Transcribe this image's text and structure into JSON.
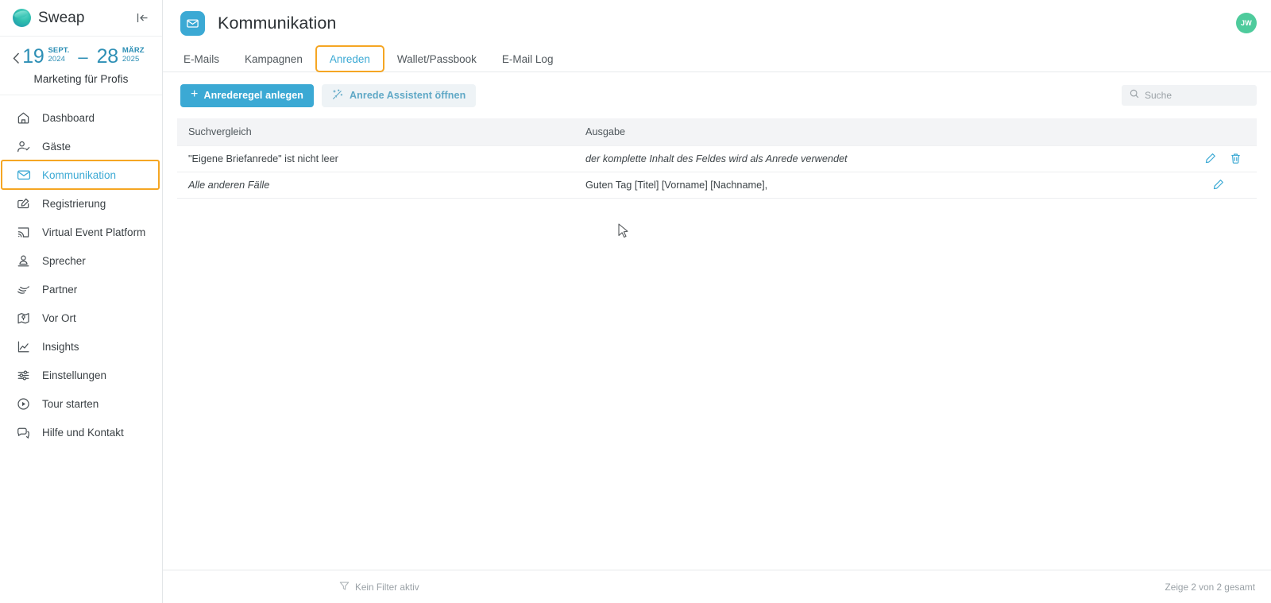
{
  "sidebar": {
    "brand": "Sweap",
    "collapse_icon": "collapse-panel-icon",
    "date_range": {
      "prev_icon": "chevron-left-icon",
      "start_day": "19",
      "start_month": "SEPT.",
      "start_year": "2024",
      "separator": "–",
      "end_day": "28",
      "end_month": "MÄRZ",
      "end_year": "2025",
      "event_name": "Marketing für Profis"
    },
    "items": [
      {
        "label": "Dashboard",
        "icon": "home-icon",
        "active": false
      },
      {
        "label": "Gäste",
        "icon": "user-check-icon",
        "active": false
      },
      {
        "label": "Kommunikation",
        "icon": "envelope-icon",
        "active": true
      },
      {
        "label": "Registrierung",
        "icon": "form-edit-icon",
        "active": false
      },
      {
        "label": "Virtual Event Platform",
        "icon": "cast-screen-icon",
        "active": false
      },
      {
        "label": "Sprecher",
        "icon": "speaker-person-icon",
        "active": false
      },
      {
        "label": "Partner",
        "icon": "handshake-icon",
        "active": false
      },
      {
        "label": "Vor Ort",
        "icon": "map-pin-icon",
        "active": false
      },
      {
        "label": "Insights",
        "icon": "chart-line-icon",
        "active": false
      },
      {
        "label": "Einstellungen",
        "icon": "sliders-icon",
        "active": false
      }
    ],
    "bottom_items": [
      {
        "label": "Tour starten",
        "icon": "play-circle-icon"
      },
      {
        "label": "Hilfe und Kontakt",
        "icon": "chat-bubbles-icon"
      }
    ]
  },
  "header": {
    "icon": "envelope-icon",
    "title": "Kommunikation",
    "avatar_initials": "JW"
  },
  "tabs": [
    {
      "label": "E-Mails",
      "active": false
    },
    {
      "label": "Kampagnen",
      "active": false
    },
    {
      "label": "Anreden",
      "active": true
    },
    {
      "label": "Wallet/Passbook",
      "active": false
    },
    {
      "label": "E-Mail Log",
      "active": false
    }
  ],
  "toolbar": {
    "create_rule_label": "Anrederegel anlegen",
    "create_rule_icon": "plus-icon",
    "assistant_label": "Anrede Assistent öffnen",
    "assistant_icon": "magic-wand-icon",
    "search_placeholder": "Suche",
    "search_value": "",
    "search_icon": "search-icon"
  },
  "table": {
    "columns": [
      "Suchvergleich",
      "Ausgabe"
    ],
    "rows": [
      {
        "match": "\"Eigene Briefanrede\" ist nicht leer",
        "match_italic": false,
        "output": "der komplette Inhalt des Feldes wird als Anrede verwendet",
        "output_italic": true,
        "edit_icon": "pencil-edit-icon",
        "delete_icon": "trash-delete-icon",
        "has_delete": true
      },
      {
        "match": "Alle anderen Fälle",
        "match_italic": true,
        "output": "Guten Tag [Titel] [Vorname] [Nachname],",
        "output_italic": false,
        "edit_icon": "pencil-edit-icon",
        "delete_icon": "",
        "has_delete": false
      }
    ]
  },
  "footer": {
    "filter_icon": "filter-funnel-icon",
    "filter_label": "Kein Filter aktiv",
    "count_label": "Zeige 2 von 2 gesamt"
  },
  "colors": {
    "accent_blue": "#3ba9d4",
    "highlight_orange": "#f5a623",
    "avatar_green": "#4ecb9c",
    "header_gray": "#f3f4f6"
  }
}
